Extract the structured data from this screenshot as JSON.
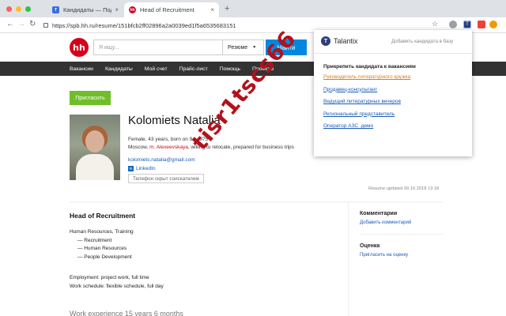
{
  "browser": {
    "tabs": [
      {
        "title": "Кандидаты — Подбор персон"
      },
      {
        "title": "Head of Recruitment"
      }
    ],
    "new_tab": "+",
    "url": "https://spb.hh.ru/resume/151bfcb2ff02896a2a0039ed1f5a6535683151",
    "colors": {
      "accent": "#d6001c"
    }
  },
  "site": {
    "logo": "hh",
    "search": {
      "placeholder": "Я ищу...",
      "mode": "Резюме",
      "button": "Найти"
    },
    "nav": [
      "Вакансии",
      "Кандидаты",
      "Мой счет",
      "Прайс-лист",
      "Помощь",
      "Проекты"
    ]
  },
  "candidate": {
    "invite": "Пригласить",
    "name": "Kolomiets Natalia",
    "meta_line1": "Female, 43 years, born on 9 ... 975",
    "meta_loc": "Moscow, ",
    "metro": "m. Alexeevskaya",
    "meta_rest": ", willing to relocate, prepared for business trips",
    "email": "kolomiets.natalia@gmail.com",
    "linkedin": "LinkedIn",
    "phone_hidden": "Телефон скрыт соискателем",
    "updated": "Resume updated 09.10.2018 13:18"
  },
  "resume": {
    "position": "Head of Recruitment",
    "specialization": "Human Resources, Training",
    "sub": [
      "— Recruitment",
      "— Human Resources",
      "— People Development"
    ],
    "employment": "Employment: project work, full time",
    "schedule": "Work schedule: flexible schedule, full day",
    "experience": "Work experience 15 years 6 months"
  },
  "sidebar": {
    "comments_title": "Комментарии",
    "comments_link": "Добавить комментарий",
    "rating_title": "Оценка",
    "rating_link": "Пригласить на оценку"
  },
  "talantix": {
    "name": "Talantix",
    "add_link": "Добавить кандидата в базу",
    "title": "Прикрепить кандидата к вакансиям",
    "vacancies": [
      "Руководитель литературного кружка",
      "Продавец-консультант",
      "Ведущий литературных вечеров",
      "Региональный представитель",
      "Оператор АЗС_демо"
    ]
  },
  "watermark": "tisr1tscs66"
}
